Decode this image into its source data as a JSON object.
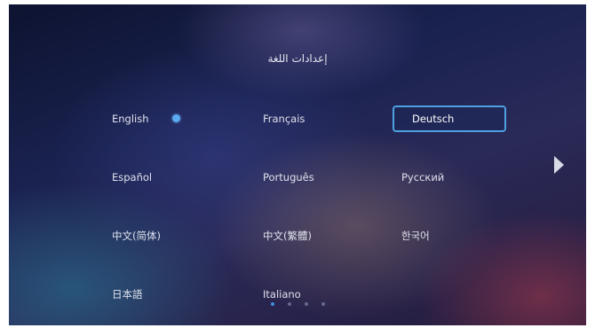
{
  "header": {
    "title": "إعدادات اللغة"
  },
  "languages": [
    {
      "label": "English",
      "selected": true
    },
    {
      "label": "Français"
    },
    {
      "label": "Deutsch",
      "focused": true
    },
    {
      "label": "Español"
    },
    {
      "label": "Português"
    },
    {
      "label": "Русский"
    },
    {
      "label": "中文(简体)"
    },
    {
      "label": "中文(繁體)"
    },
    {
      "label": "한국어"
    },
    {
      "label": "日本語"
    },
    {
      "label": "Italiano"
    }
  ],
  "pagination": {
    "pages": 4,
    "current": 1
  },
  "colors": {
    "focus_border": "#4ea0e0",
    "selected_indicator": "#5aaaf0",
    "active_page_dot": "#3f8fe0"
  }
}
